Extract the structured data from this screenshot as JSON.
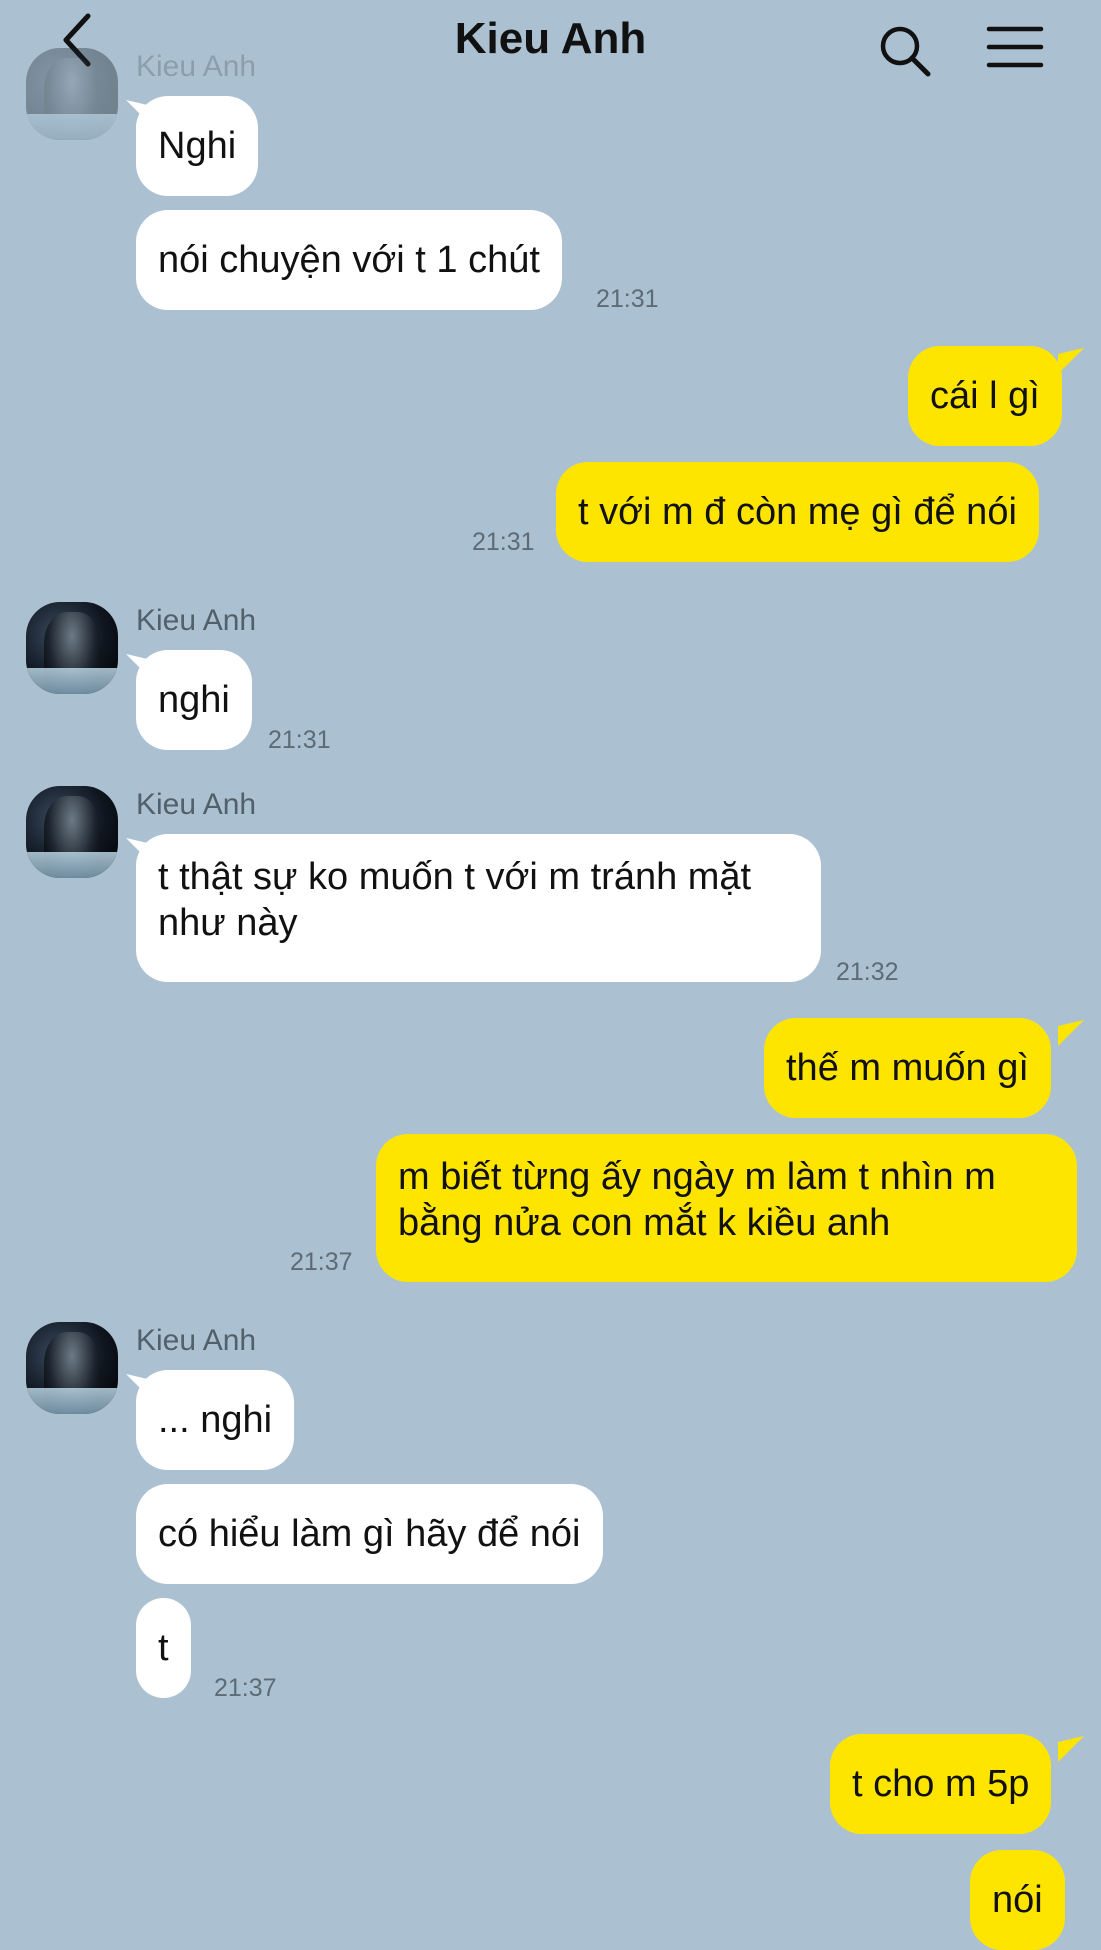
{
  "header": {
    "title": "Kieu Anh",
    "back_icon": "chevron-left-icon",
    "search_icon": "search-icon",
    "menu_icon": "hamburger-menu-icon"
  },
  "colors": {
    "background": "#abc1d1",
    "incoming_bubble": "#ffffff",
    "outgoing_bubble": "#fee500",
    "timestamp": "#5d6b76"
  },
  "messages": [
    {
      "sender": "Kieu Anh",
      "direction": "in",
      "text": "Nghi"
    },
    {
      "direction": "in",
      "text": "nói chuyện với t 1 chút",
      "time": "21:31"
    },
    {
      "direction": "out",
      "text": "cái l gì"
    },
    {
      "direction": "out",
      "text": "t với m đ còn mẹ gì để nói",
      "time": "21:31"
    },
    {
      "sender": "Kieu Anh",
      "direction": "in",
      "text": "nghi",
      "time": "21:31"
    },
    {
      "sender": "Kieu Anh",
      "direction": "in",
      "text": "t thật sự ko muốn t với m tránh mặt như này",
      "time": "21:32"
    },
    {
      "direction": "out",
      "text": "thế m muốn gì"
    },
    {
      "direction": "out",
      "text": "m biết từng ấy ngày m làm t nhìn m bằng nửa con mắt k kiều anh",
      "time": "21:37"
    },
    {
      "sender": "Kieu Anh",
      "direction": "in",
      "text": "... nghi"
    },
    {
      "direction": "in",
      "text": "có hiểu làm gì hãy để nói"
    },
    {
      "direction": "in",
      "text": "t",
      "time": "21:37"
    },
    {
      "direction": "out",
      "text": "t cho m 5p"
    },
    {
      "direction": "out",
      "text": "nói"
    }
  ]
}
